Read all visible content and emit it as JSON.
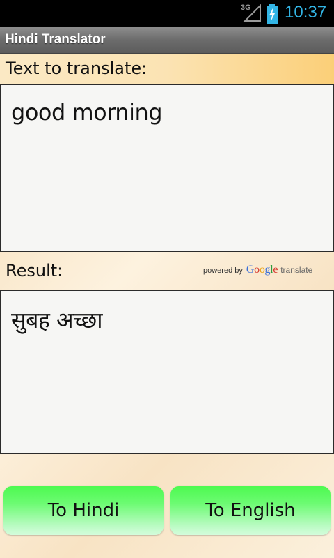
{
  "status_bar": {
    "network": "3G",
    "time": "10:37",
    "signal_icon": "signal-icon",
    "battery_icon": "battery-charging-icon",
    "time_color": "#33b5e5"
  },
  "app": {
    "title": "Hindi Translator"
  },
  "source": {
    "label": "Text to translate:",
    "value": "good morning"
  },
  "result": {
    "label": "Result:",
    "value": "सुबह अच्छा"
  },
  "attribution": {
    "powered_by": "powered by",
    "google": "Google",
    "translate": "translate"
  },
  "buttons": {
    "to_hindi": "To Hindi",
    "to_english": "To English",
    "color": "#4dfa50"
  }
}
